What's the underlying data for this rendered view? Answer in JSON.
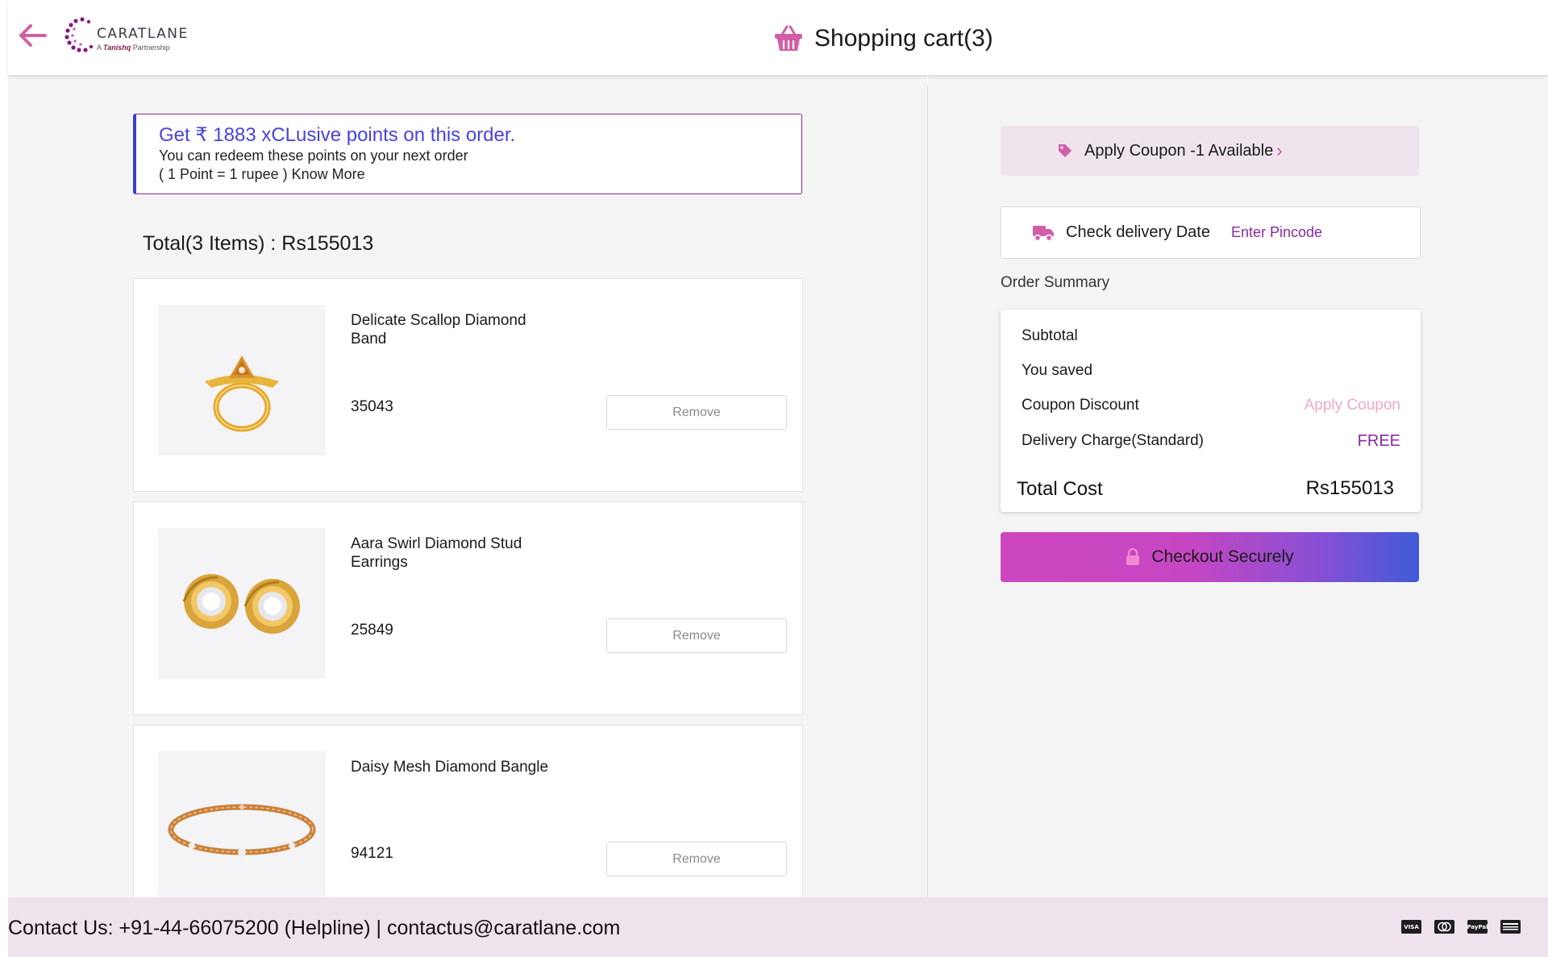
{
  "header": {
    "back_icon": "arrow-left-icon",
    "logo": {
      "name": "CARATLANE",
      "tagline_prefix": "A",
      "tagline_brand": "Tanishq",
      "tagline_suffix": "Partnership"
    },
    "cart_icon": "shopping-basket-icon",
    "title": "Shopping cart(3)"
  },
  "points_banner": {
    "title": "Get ₹ 1883 xCLusive points on this order.",
    "line1": "You can redeem these points on your next order",
    "line2_prefix": "( 1 Point = 1 rupee )",
    "know_more": "Know More"
  },
  "cart": {
    "total_label": "Total(3 Items) : Rs155013",
    "items": [
      {
        "name": "Delicate Scallop Diamond Band",
        "price": "35043",
        "remove_label": "Remove",
        "image_icon": "ring-icon"
      },
      {
        "name": "Aara Swirl Diamond Stud Earrings",
        "price": "25849",
        "remove_label": "Remove",
        "image_icon": "earrings-icon"
      },
      {
        "name": "Daisy Mesh Diamond Bangle",
        "price": "94121",
        "remove_label": "Remove",
        "image_icon": "bangle-icon"
      }
    ]
  },
  "coupon": {
    "icon": "tag-icon",
    "label": "Apply Coupon -1 Available",
    "chevron": "›"
  },
  "delivery": {
    "icon": "truck-icon",
    "label": "Check delivery Date",
    "pincode_link": "Enter Pincode"
  },
  "order_summary": {
    "heading": "Order Summary",
    "subtotal_label": "Subtotal",
    "saved_label": "You saved",
    "coupon_discount_label": "Coupon Discount",
    "apply_coupon_link": "Apply Coupon",
    "delivery_label": "Delivery Charge(Standard)",
    "delivery_value": "FREE",
    "total_label": "Total Cost",
    "total_value": "Rs155013"
  },
  "checkout": {
    "icon": "lock-icon",
    "label": "Checkout Securely"
  },
  "footer": {
    "contact": "Contact Us: +91-44-66075200 (Helpline) | contactus@caratlane.com",
    "payment_icons": [
      "VISA",
      "MC",
      "PayPal",
      "AMEX"
    ]
  },
  "colors": {
    "accent": "#d04aa6",
    "link_purple": "#8a2aa0",
    "points_blue": "#4a43d8",
    "footer_bg": "#eee2ed"
  }
}
